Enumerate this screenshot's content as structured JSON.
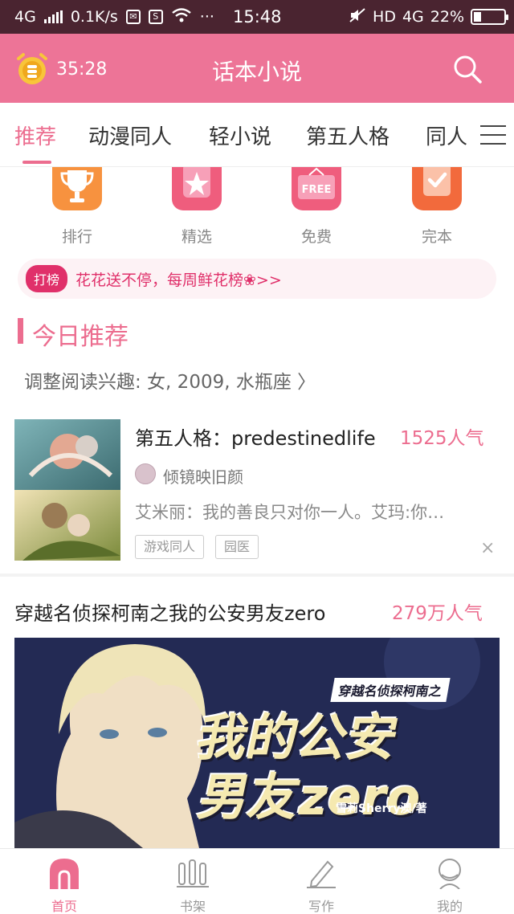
{
  "status_bar": {
    "network": "4G",
    "speed": "0.1K/s",
    "s_icon_text": "S",
    "dots": "···",
    "time": "15:48",
    "hd": "HD",
    "network2": "4G",
    "battery": "22%"
  },
  "header": {
    "timer": "35:28",
    "title": "话本小说"
  },
  "tabs": [
    {
      "label": "推荐"
    },
    {
      "label": "动漫同人"
    },
    {
      "label": "轻小说"
    },
    {
      "label": "第五人格"
    },
    {
      "label": "同人"
    }
  ],
  "quick_entries": [
    {
      "label": "排行",
      "icon": "trophy-icon",
      "color": "#f7923f"
    },
    {
      "label": "精选",
      "icon": "star-icon",
      "color": "#ef5d7d"
    },
    {
      "label": "免费",
      "icon": "free-icon",
      "color": "#ef5d7d",
      "icon_text": "FREE"
    },
    {
      "label": "完本",
      "icon": "check-icon",
      "color": "#f26a3c"
    }
  ],
  "promo": {
    "badge": "打榜",
    "text": "花花送不停，每周鲜花榜❀>>"
  },
  "section": {
    "title": "今日推荐",
    "interest": "调整阅读兴趣: 女, 2009, 水瓶座 〉"
  },
  "book1": {
    "title": "第五人格：predestinedlife",
    "popularity": "1525人气",
    "author": "倾镜映旧颜",
    "description": "艾米丽：我的善良只对你一人。艾玛:你…",
    "tags": [
      "游戏同人",
      "园医"
    ],
    "close": "×"
  },
  "book2": {
    "title": "穿越名侦探柯南之我的公安男友zero",
    "popularity": "279万人气",
    "banner_subtitle": "穿越名侦探柯南之",
    "banner_line1": "我的公安",
    "banner_line2": "男友zero",
    "banner_author": "雪莉Sherry澳/著"
  },
  "bottom_nav": [
    {
      "label": "首页",
      "active": true
    },
    {
      "label": "书架",
      "active": false
    },
    {
      "label": "写作",
      "active": false
    },
    {
      "label": "我的",
      "active": false
    }
  ],
  "colors": {
    "accent": "#ec6d8f",
    "header_bg": "#ed7497",
    "status_bg": "#4a2430"
  }
}
